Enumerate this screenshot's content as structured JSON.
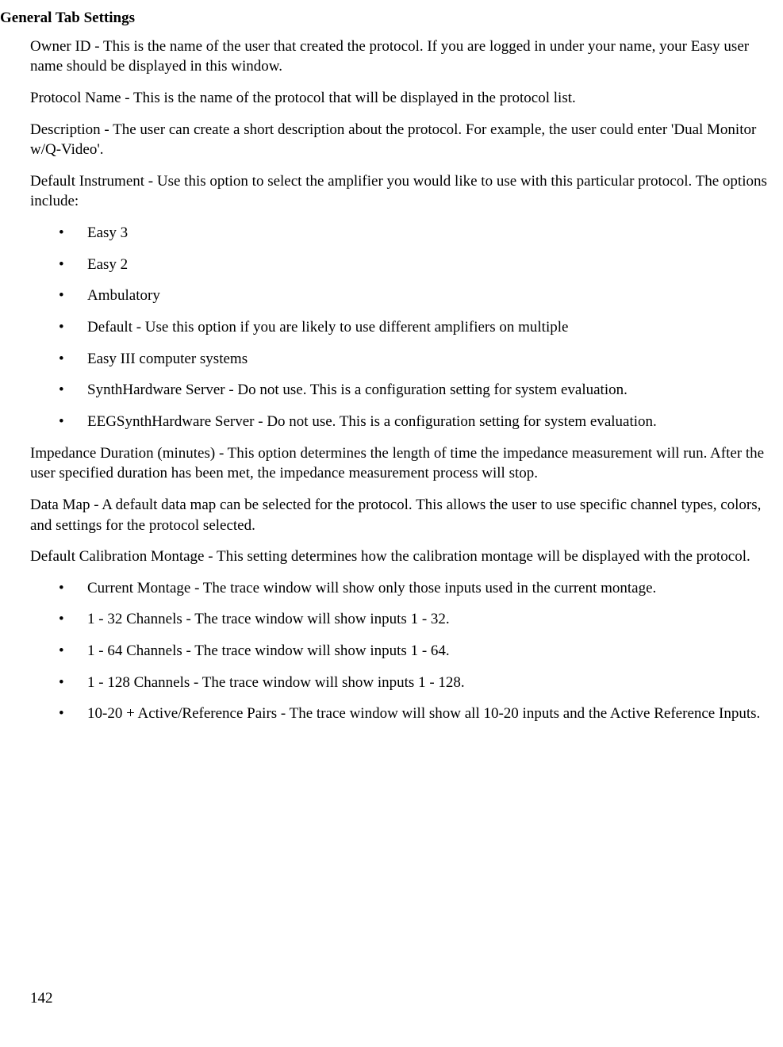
{
  "heading": "General Tab Settings",
  "paragraphs": {
    "owner_id": "Owner ID - This is the name of the user that created the protocol.  If you are logged in under your name, your Easy user name should be displayed in this window.",
    "protocol_name": "Protocol Name - This is the name of the protocol that will be displayed in the protocol list.",
    "description": "Description - The user can create a short description about the protocol.  For example, the user could enter 'Dual Monitor w/Q-Video'.",
    "default_instrument": "Default Instrument - Use this option to select the amplifier you would like to use with this particular protocol.  The options include:",
    "impedance": "Impedance Duration (minutes) - This option determines the length of time the impedance measurement will run.  After the user specified duration has been met, the impedance measurement process will stop.",
    "data_map": "Data Map - A default data map can be selected for the protocol.  This allows the user to use specific channel types, colors, and settings for the protocol selected.",
    "calibration": "Default Calibration Montage -  This setting determines how the calibration montage will be displayed with the protocol."
  },
  "instrument_list": [
    "Easy 3",
    "Easy 2",
    "Ambulatory",
    "Default - Use this option if you are likely to use different amplifiers on multiple",
    "Easy III computer systems",
    "SynthHardware Server - Do not use.  This is a configuration setting for system evaluation.",
    "EEGSynthHardware Server - Do not use.  This is a configuration setting for system evaluation."
  ],
  "calibration_list": [
    "Current Montage - The trace window will show only those inputs used in the current montage.",
    "1 - 32 Channels - The trace window will show inputs 1 - 32.",
    "1 - 64 Channels - The trace window will show inputs 1 - 64.",
    "1 - 128 Channels - The trace window will show inputs 1 - 128.",
    "10-20 + Active/Reference Pairs - The trace window will show all 10-20 inputs and the Active Reference Inputs."
  ],
  "page_number": "142"
}
